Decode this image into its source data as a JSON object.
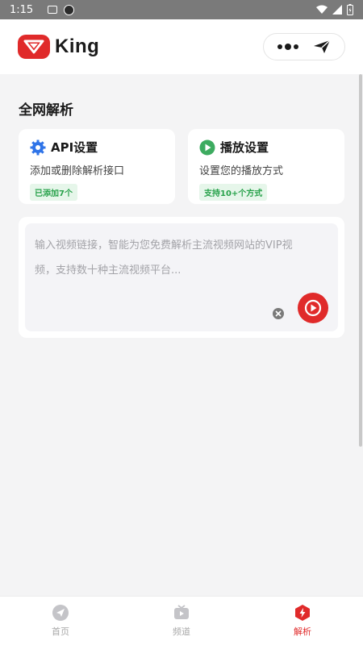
{
  "status_bar": {
    "time": "1:15"
  },
  "header": {
    "logo_text": "King"
  },
  "section_title": "全网解析",
  "cards": [
    {
      "title": "API设置",
      "subtitle": "添加或删除解析接口",
      "tag": "已添加7个",
      "icon": "gear-icon",
      "icon_color": "#2f74e8"
    },
    {
      "title": "播放设置",
      "subtitle": "设置您的播放方式",
      "tag": "支持10+个方式",
      "icon": "play-circle-icon",
      "icon_color": "#3dab60"
    }
  ],
  "input": {
    "placeholder_line1": "输入视频链接，智能为您免费解析主流视频网站的VIP视",
    "placeholder_line2": "频，支持数十种主流视频平台..."
  },
  "tabs": [
    {
      "label": "首页",
      "icon": "send-circle-icon",
      "active": false
    },
    {
      "label": "频道",
      "icon": "tv-icon",
      "active": false
    },
    {
      "label": "解析",
      "icon": "lightning-shield-icon",
      "active": true
    }
  ],
  "colors": {
    "brand": "#e02a2a",
    "tag_green": "#27a14a",
    "background": "#f4f4f5"
  }
}
